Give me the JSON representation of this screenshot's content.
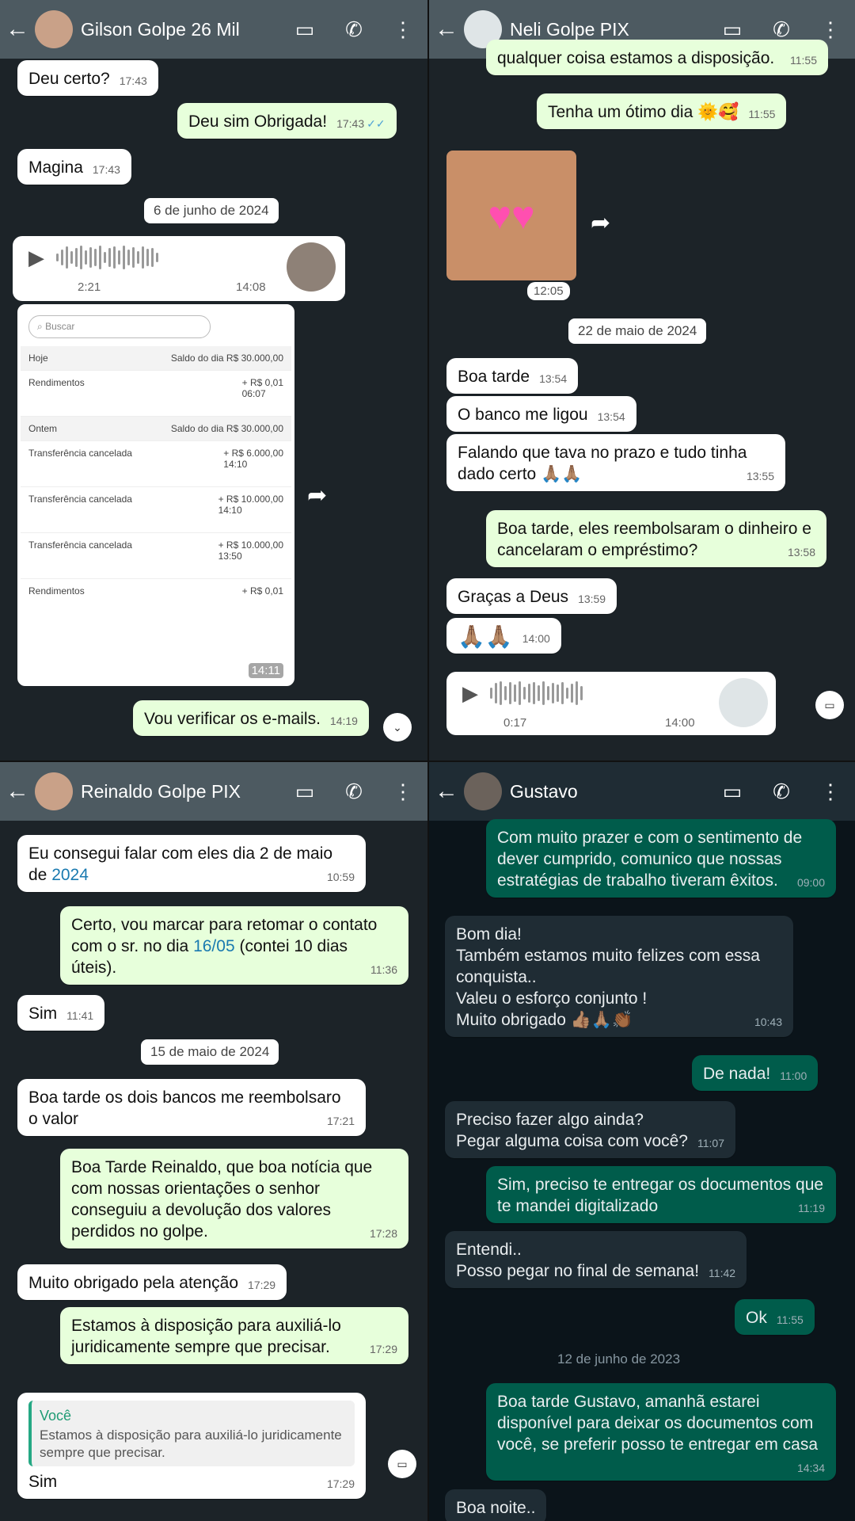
{
  "p1": {
    "title": "Gilson Golpe 26 Mil",
    "header_icons": [
      "back-arrow-icon",
      "video-call-icon",
      "phone-icon",
      "more-vert-icon"
    ],
    "m1": {
      "text": "Deu certo?",
      "time": "17:43"
    },
    "m2": {
      "text": "Deu sim Obrigada!",
      "time": "17:43"
    },
    "m3": {
      "text": "Magina",
      "time": "17:43"
    },
    "date": "6 de junho de 2024",
    "voice": {
      "duration": "2:21",
      "time": "14:08"
    },
    "screen": {
      "search": "Buscar",
      "today": "Hoje",
      "today_saldo": "Saldo do dia R$ 30.000,00",
      "r1": "Rendimentos",
      "r1v": "+ R$ 0,01",
      "r1t": "06:07",
      "older": "Ontem",
      "older_saldo": "Saldo do dia R$ 30.000,00",
      "r2": "Transferência cancelada",
      "r2v": "+ R$ 6.000,00",
      "r2t": "14:10",
      "r3": "Transferência cancelada",
      "r3v": "+ R$ 10.000,00",
      "r3t": "14:10",
      "r4": "Transferência cancelada",
      "r4v": "+ R$ 10.000,00",
      "r4t": "13:50",
      "r5": "Rendimentos",
      "r5v": "+ R$ 0,01",
      "time": "14:11"
    },
    "m4": {
      "text": "Vou verificar os e-mails.",
      "time": "14:19"
    }
  },
  "p2": {
    "title": "Neli Golpe PIX",
    "m0": {
      "text": "qualquer coisa estamos a disposição.",
      "time": "11:55"
    },
    "m1": {
      "text": "Tenha um ótimo dia 🌞🥰",
      "time": "11:55"
    },
    "sticker_time": "12:05",
    "date": "22 de maio de 2024",
    "m2": {
      "text": "Boa tarde",
      "time": "13:54"
    },
    "m3": {
      "text": "O banco me ligou",
      "time": "13:54"
    },
    "m4": {
      "text": "Falando que tava no prazo e tudo tinha dado certo 🙏🏽🙏🏽",
      "time": "13:55"
    },
    "m5": {
      "text": "Boa tarde, eles reembolsaram o dinheiro e cancelaram o empréstimo?",
      "time": "13:58"
    },
    "m6": {
      "text": "Graças a Deus",
      "time": "13:59"
    },
    "m7": {
      "text": "🙏🏽🙏🏽",
      "time": "14:00"
    },
    "voice": {
      "duration": "0:17",
      "time": "14:00"
    }
  },
  "p3": {
    "title": "Reinaldo Golpe PIX",
    "m1": {
      "text": "Eu consegui falar com eles dia 2 de maio de ",
      "link": "2024",
      "time": "10:59"
    },
    "m2": {
      "text": "Certo, vou marcar para retomar o contato com o sr. no dia ",
      "link": "16/05",
      "text2": " (contei 10 dias úteis).",
      "time": "11:36"
    },
    "m3": {
      "text": "Sim",
      "time": "11:41"
    },
    "date": "15 de maio de 2024",
    "m4": {
      "text": "Boa tarde os dois bancos me reembolsaro o valor",
      "time": "17:21"
    },
    "m5": {
      "text": "Boa Tarde Reinaldo, que boa notícia que com nossas orientações o senhor conseguiu a devolução dos valores perdidos no golpe.",
      "time": "17:28"
    },
    "m6": {
      "text": "Muito obrigado pela atenção",
      "time": "17:29"
    },
    "m7": {
      "text": "Estamos à disposição para auxiliá-lo juridicamente sempre que precisar.",
      "time": "17:29"
    },
    "m8": {
      "who": "Você",
      "quote": "Estamos à disposição para auxiliá-lo juridicamente sempre que precisar.",
      "text": "Sim",
      "time": "17:29"
    }
  },
  "p4": {
    "title": "Gustavo",
    "m1": {
      "text": "Com muito prazer e com o sentimento de dever cumprido, comunico que nossas estratégias de trabalho tiveram êxitos.",
      "time": "09:00"
    },
    "m2": {
      "text": "Bom dia!\nTambém estamos muito felizes com essa conquista..\nValeu o esforço conjunto !\nMuito obrigado 👍🏽🙏🏽👏🏾",
      "time": "10:43"
    },
    "m3": {
      "text": "De nada!",
      "time": "11:00"
    },
    "m4": {
      "text": "Preciso fazer algo ainda?\nPegar alguma coisa com você?",
      "time": "11:07"
    },
    "m5": {
      "text": "Sim, preciso te entregar os documentos que te mandei digitalizado",
      "time": "11:19"
    },
    "m6": {
      "text": "Entendi..\nPosso pegar no final de semana!",
      "time": "11:42"
    },
    "m7": {
      "text": "Ok",
      "time": "11:55"
    },
    "date": "12 de junho de 2023",
    "m8": {
      "text": "Boa tarde Gustavo, amanhã estarei disponível para deixar os documentos com você, se preferir posso te entregar em casa",
      "time": "14:34"
    },
    "m9": {
      "text": "Boa noite..",
      "time": ""
    }
  }
}
